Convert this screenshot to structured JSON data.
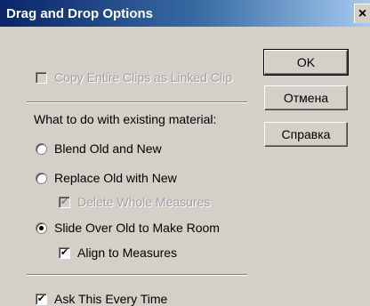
{
  "window": {
    "title": "Drag and Drop Options",
    "close_glyph": "×"
  },
  "options": {
    "copy_linked": {
      "label": "Copy Entire Clips as Linked Clip",
      "checked": false,
      "enabled": false
    },
    "section_label": "What to do with existing material:",
    "blend": {
      "label": "Blend Old and New",
      "selected": false
    },
    "replace": {
      "label": "Replace Old with New",
      "selected": false
    },
    "delete_measures": {
      "label": "Delete Whole Measures",
      "checked": true,
      "enabled": false
    },
    "slide": {
      "label": "Slide Over Old to Make Room",
      "selected": true
    },
    "align_measures": {
      "label": "Align to Measures",
      "checked": true,
      "enabled": true
    },
    "ask_every_time": {
      "label": "Ask This Every Time",
      "checked": true,
      "enabled": true
    }
  },
  "buttons": {
    "ok": "OK",
    "cancel": "Отмена",
    "help": "Справка"
  },
  "check_glyph": "✔"
}
